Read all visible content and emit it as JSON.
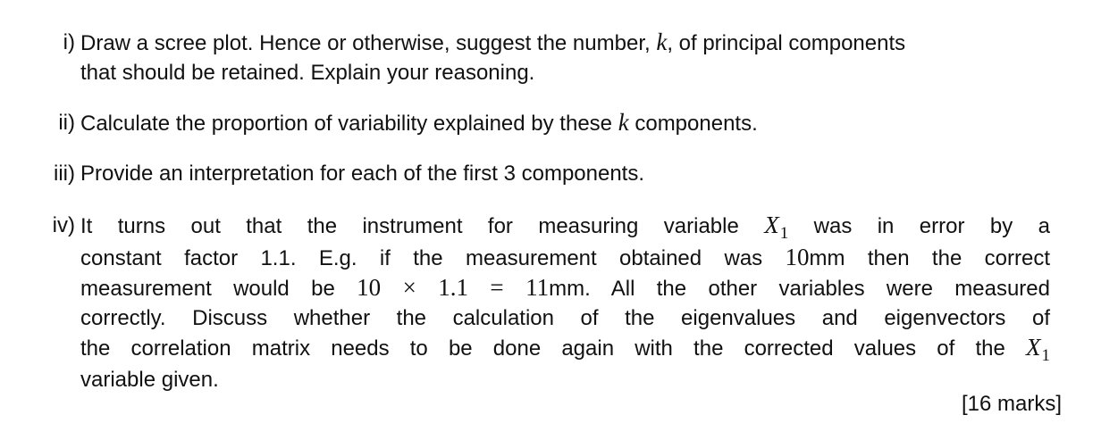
{
  "items": [
    {
      "marker": "i)",
      "lines": [
        {
          "a": "Draw a scree plot. Hence or otherwise, suggest the number, ",
          "var": "k",
          "b": ", of principal components"
        },
        {
          "text": "that should be retained. Explain your reasoning."
        }
      ]
    },
    {
      "marker": "ii)",
      "a": "Calculate the proportion of variability explained by these ",
      "var": "k",
      "b": " components."
    },
    {
      "marker": "iii)",
      "text": "Provide an interpretation for each of the first 3 components."
    },
    {
      "marker": "iv)",
      "l1": {
        "a": "It turns out that the instrument for measuring variable ",
        "var": "X",
        "sub": "1",
        "b": " was in error by a"
      },
      "l2": {
        "a": "constant factor 1.1. E.g. if the measurement obtained was ",
        "num": "10",
        "b": "mm then the correct"
      },
      "l3": {
        "a": "measurement would be ",
        "expr": "10 × 1.1 = 11",
        "b": "mm. All the other variables were measured"
      },
      "l4": {
        "text": "correctly. Discuss whether the calculation of the eigenvalues and eigenvectors of"
      },
      "l5": {
        "a": "the correlation matrix needs to be done again with the corrected values of the ",
        "var": "X",
        "sub": "1"
      },
      "l6": {
        "text": "variable given."
      }
    }
  ],
  "marks": "[16 marks]"
}
